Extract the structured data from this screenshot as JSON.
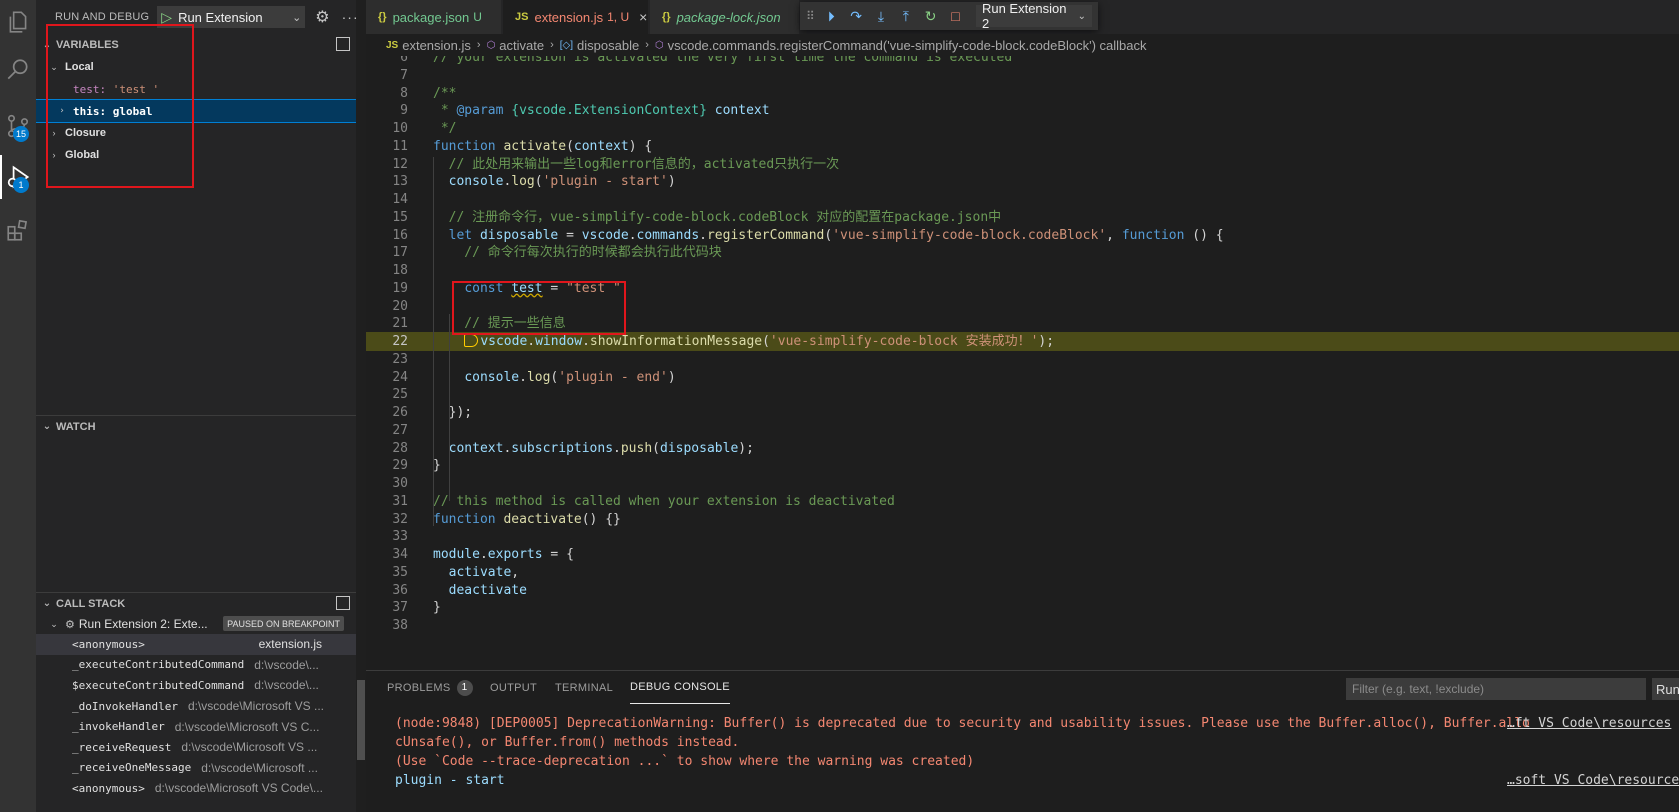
{
  "activity_bar": {
    "items": [
      {
        "icon": "files-icon"
      },
      {
        "icon": "search-icon"
      },
      {
        "icon": "source-control-icon",
        "badge": "15"
      },
      {
        "icon": "run-debug-icon",
        "badge": "1"
      },
      {
        "icon": "extensions-icon"
      }
    ]
  },
  "sidebar": {
    "title": "RUN AND DEBUG",
    "config": "Run Extension",
    "variables": {
      "header": "VARIABLES",
      "local": "Local",
      "test_name": "test:",
      "test_value": "'test '",
      "this_row": "this: global",
      "closure": "Closure",
      "global": "Global"
    },
    "watch": {
      "header": "WATCH"
    },
    "call_stack": {
      "header": "CALL STACK",
      "thread": "Run Extension 2: Exte...",
      "paused": "PAUSED ON BREAKPOINT",
      "frames": [
        {
          "fn": "<anonymous>",
          "file": "extension.js"
        },
        {
          "fn": "_executeContributedCommand",
          "file": "d:\\vscode\\..."
        },
        {
          "fn": "$executeContributedCommand",
          "file": "d:\\vscode\\..."
        },
        {
          "fn": "_doInvokeHandler",
          "file": "d:\\vscode\\Microsoft VS ..."
        },
        {
          "fn": "_invokeHandler",
          "file": "d:\\vscode\\Microsoft VS C..."
        },
        {
          "fn": "_receiveRequest",
          "file": "d:\\vscode\\Microsoft VS ..."
        },
        {
          "fn": "_receiveOneMessage",
          "file": "d:\\vscode\\Microsoft ..."
        },
        {
          "fn": "<anonymous>",
          "file": "d:\\vscode\\Microsoft VS Code\\..."
        }
      ]
    }
  },
  "tabs": [
    {
      "icon": "{}",
      "label": "package.json",
      "flag": "U"
    },
    {
      "icon": "JS",
      "label": "extension.js",
      "flag": "1, U"
    },
    {
      "icon": "{}",
      "label": "package-lock.json",
      "flag": ""
    }
  ],
  "debug_toolbar": {
    "session": "Run Extension 2"
  },
  "breadcrumb": {
    "items": [
      "extension.js",
      "activate",
      "disposable",
      "vscode.commands.registerCommand('vue-simplify-code-block.codeBlock') callback"
    ]
  },
  "editor": {
    "current_line": 22,
    "lines": [
      {
        "n": "6",
        "code": "// your extension is activated the very first time the command is executed"
      },
      {
        "n": "7",
        "code": ""
      },
      {
        "n": "8",
        "code": "/**"
      },
      {
        "n": "9",
        "code": " * @param {vscode.ExtensionContext} context"
      },
      {
        "n": "10",
        "code": " */"
      },
      {
        "n": "11",
        "code": "function activate(context) {"
      },
      {
        "n": "12",
        "code": "  // 此处用来输出一些log和error信息的，activated只执行一次"
      },
      {
        "n": "13",
        "code": "  console.log('plugin - start')"
      },
      {
        "n": "14",
        "code": ""
      },
      {
        "n": "15",
        "code": "  // 注册命令行，vue-simplify-code-block.codeBlock 对应的配置在package.json中"
      },
      {
        "n": "16",
        "code": "  let disposable = vscode.commands.registerCommand('vue-simplify-code-block.codeBlock', function () {"
      },
      {
        "n": "17",
        "code": "    // 命令行每次执行的时候都会执行此代码块"
      },
      {
        "n": "18",
        "code": ""
      },
      {
        "n": "19",
        "code": "    const test = \"test \""
      },
      {
        "n": "20",
        "code": ""
      },
      {
        "n": "21",
        "code": "    // 提示一些信息"
      },
      {
        "n": "22",
        "code": "    vscode.window.showInformationMessage('vue-simplify-code-block 安装成功！');"
      },
      {
        "n": "23",
        "code": ""
      },
      {
        "n": "24",
        "code": "    console.log('plugin - end')"
      },
      {
        "n": "25",
        "code": ""
      },
      {
        "n": "26",
        "code": "  });"
      },
      {
        "n": "27",
        "code": ""
      },
      {
        "n": "28",
        "code": "  context.subscriptions.push(disposable);"
      },
      {
        "n": "29",
        "code": "}"
      },
      {
        "n": "30",
        "code": ""
      },
      {
        "n": "31",
        "code": "// this method is called when your extension is deactivated"
      },
      {
        "n": "32",
        "code": "function deactivate() {}"
      },
      {
        "n": "33",
        "code": ""
      },
      {
        "n": "34",
        "code": "module.exports = {"
      },
      {
        "n": "35",
        "code": "  activate,"
      },
      {
        "n": "36",
        "code": "  deactivate"
      },
      {
        "n": "37",
        "code": "}"
      },
      {
        "n": "38",
        "code": ""
      }
    ]
  },
  "panel": {
    "tabs": [
      "PROBLEMS",
      "OUTPUT",
      "TERMINAL",
      "DEBUG CONSOLE"
    ],
    "problems_count": "1",
    "filter_placeholder": "Filter (e.g. text, !exclude)",
    "run_label": "Run",
    "console": {
      "lines": [
        "(node:9848) [DEP0005] DeprecationWarning: Buffer() is deprecated due to security and usability issues. Please use the Buffer.alloc(), Buffer.allo",
        "cUnsafe(), or Buffer.from() methods instead.",
        "(Use `Code --trace-deprecation ...` to show where the warning was created)",
        "plugin - start"
      ],
      "sources": [
        "…ft VS Code\\resources",
        "…soft VS Code\\resources"
      ]
    }
  },
  "colors": {
    "accent": "#007acc",
    "annotation": "#e0161c",
    "current_line": "#4b4b18"
  }
}
